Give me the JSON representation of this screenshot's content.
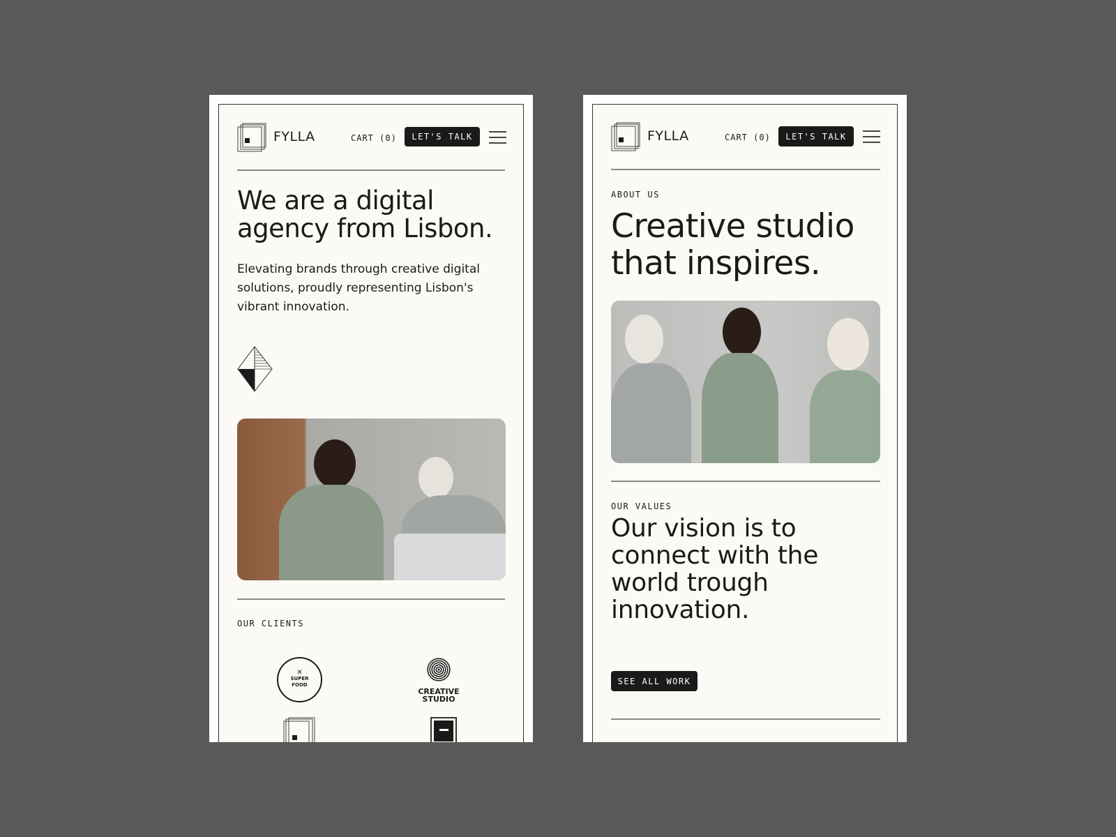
{
  "header": {
    "brand": "FYLLA",
    "cart": "CART (0)",
    "cta": "LET'S TALK"
  },
  "home": {
    "heading_line1": "We are a digital",
    "heading_line2": "agency from Lisbon.",
    "intro": "Elevating brands through creative digital solutions, proudly representing Lisbon's vibrant innovation.",
    "clients_label": "OUR CLIENTS",
    "clients": [
      {
        "line1": "SUPER",
        "line2": "FOOD"
      },
      {
        "line1": "CREATIVE",
        "line2": "STUDIO"
      }
    ]
  },
  "about": {
    "label": "ABOUT US",
    "heading_line1": "Creative studio",
    "heading_line2": "that inspires.",
    "values_label": "OUR VALUES",
    "values_heading": [
      "Our vision is to",
      "connect with the",
      "world trough",
      "innovation."
    ],
    "button": "SEE ALL WORK"
  }
}
